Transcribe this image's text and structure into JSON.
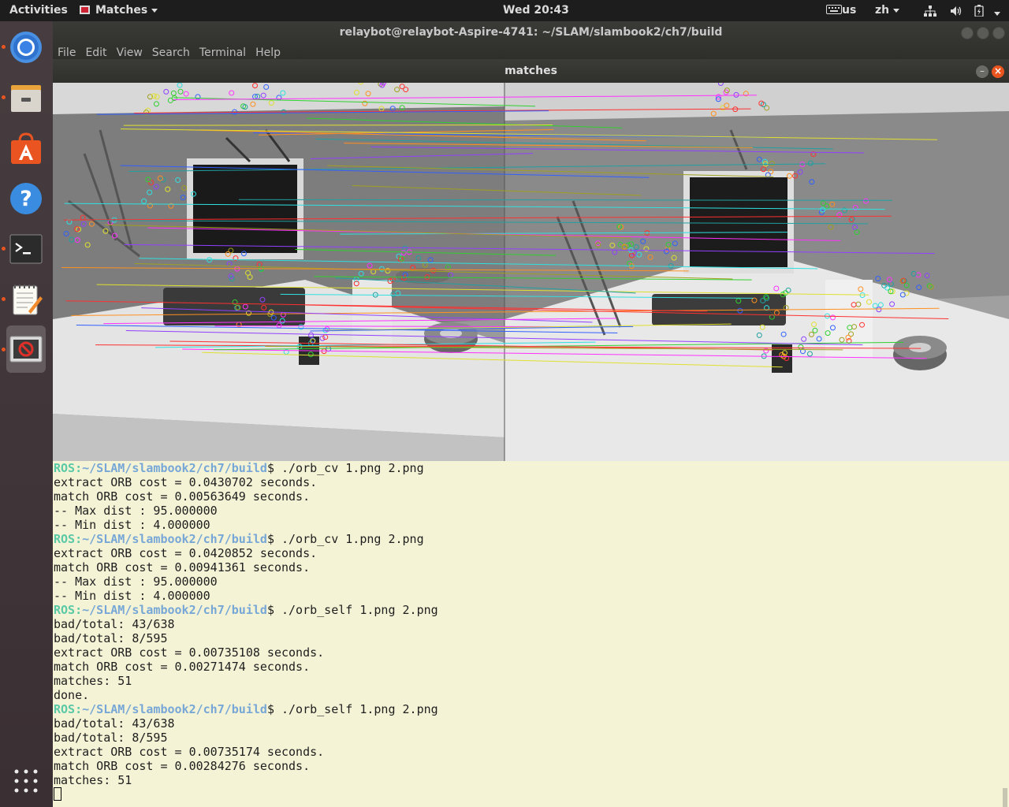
{
  "topbar": {
    "activities": "Activities",
    "app_menu": "Matches",
    "clock": "Wed 20:43",
    "keyboard": "us",
    "input_method": "zh"
  },
  "dock": {
    "items": [
      {
        "name": "chrome",
        "active": false,
        "running": true
      },
      {
        "name": "files",
        "active": false,
        "running": true
      },
      {
        "name": "software",
        "active": false,
        "running": false
      },
      {
        "name": "help",
        "active": false,
        "running": false
      },
      {
        "name": "terminal",
        "active": false,
        "running": true
      },
      {
        "name": "text-editor",
        "active": false,
        "running": true
      },
      {
        "name": "matches-window",
        "active": true,
        "running": true
      }
    ]
  },
  "terminal": {
    "title": "relaybot@relaybot-Aspire-4741: ~/SLAM/slambook2/ch7/build",
    "menu": [
      "File",
      "Edit",
      "View",
      "Search",
      "Terminal",
      "Help"
    ],
    "prompt_user": "ROS:",
    "prompt_path": "~/SLAM/slambook2/ch7/build",
    "lines": [
      {
        "type": "prompt",
        "cmd": "$ ./orb_cv 1.png 2.png"
      },
      {
        "type": "out",
        "text": "extract ORB cost = 0.0430702 seconds."
      },
      {
        "type": "out",
        "text": "match ORB cost = 0.00563649 seconds."
      },
      {
        "type": "out",
        "text": "-- Max dist : 95.000000"
      },
      {
        "type": "out",
        "text": "-- Min dist : 4.000000"
      },
      {
        "type": "prompt",
        "cmd": "$ ./orb_cv 1.png 2.png"
      },
      {
        "type": "out",
        "text": "extract ORB cost = 0.0420852 seconds."
      },
      {
        "type": "out",
        "text": "match ORB cost = 0.00941361 seconds."
      },
      {
        "type": "out",
        "text": "-- Max dist : 95.000000"
      },
      {
        "type": "out",
        "text": "-- Min dist : 4.000000"
      },
      {
        "type": "prompt",
        "cmd": "$ ./orb_self 1.png 2.png"
      },
      {
        "type": "out",
        "text": "bad/total: 43/638"
      },
      {
        "type": "out",
        "text": "bad/total: 8/595"
      },
      {
        "type": "out",
        "text": "extract ORB cost = 0.00735108 seconds."
      },
      {
        "type": "out",
        "text": "match ORB cost = 0.00271474 seconds."
      },
      {
        "type": "out",
        "text": "matches: 51"
      },
      {
        "type": "out",
        "text": "done."
      },
      {
        "type": "prompt",
        "cmd": "$ ./orb_self 1.png 2.png"
      },
      {
        "type": "out",
        "text": "bad/total: 43/638"
      },
      {
        "type": "out",
        "text": "bad/total: 8/595"
      },
      {
        "type": "out",
        "text": "extract ORB cost = 0.00735174 seconds."
      },
      {
        "type": "out",
        "text": "match ORB cost = 0.00284276 seconds."
      },
      {
        "type": "out",
        "text": "matches: 51"
      }
    ]
  },
  "matches_window": {
    "title": "matches"
  },
  "colors": {
    "topbar": "#1d1d1d",
    "terminal_bg": "#f4f3d6",
    "prompt_user": "#5ac9a6",
    "prompt_path": "#77a7d6",
    "accent": "#e95420"
  }
}
